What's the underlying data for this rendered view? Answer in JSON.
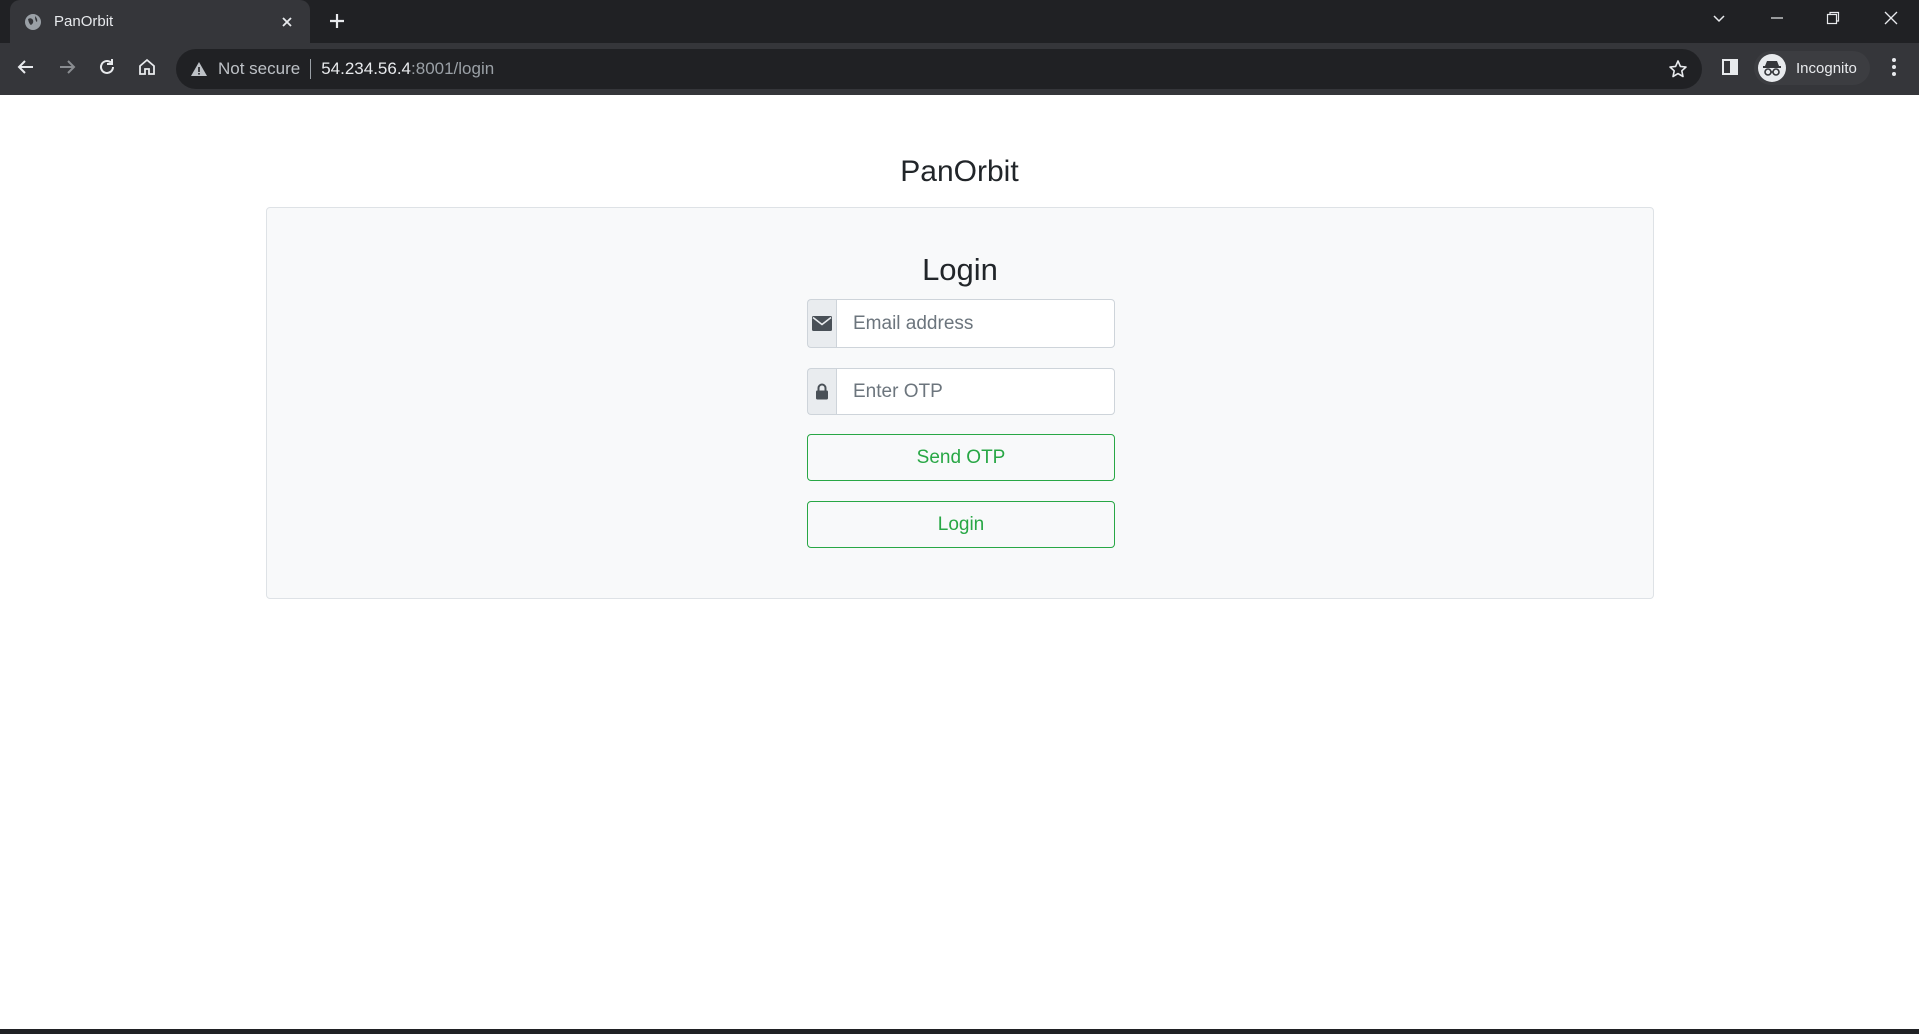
{
  "browser": {
    "tab_title": "PanOrbit",
    "omnibox": {
      "security_label": "Not secure",
      "url_host": "54.234.56.4",
      "url_rest": ":8001/login"
    },
    "profile_label": "Incognito"
  },
  "page": {
    "brand": "PanOrbit",
    "form": {
      "title": "Login",
      "email_placeholder": "Email address",
      "otp_placeholder": "Enter OTP",
      "send_otp_label": "Send OTP",
      "login_label": "Login"
    }
  },
  "colors": {
    "accent_green": "#28a745",
    "card_background": "#f8f9fa",
    "chrome_dark": "#202124"
  }
}
